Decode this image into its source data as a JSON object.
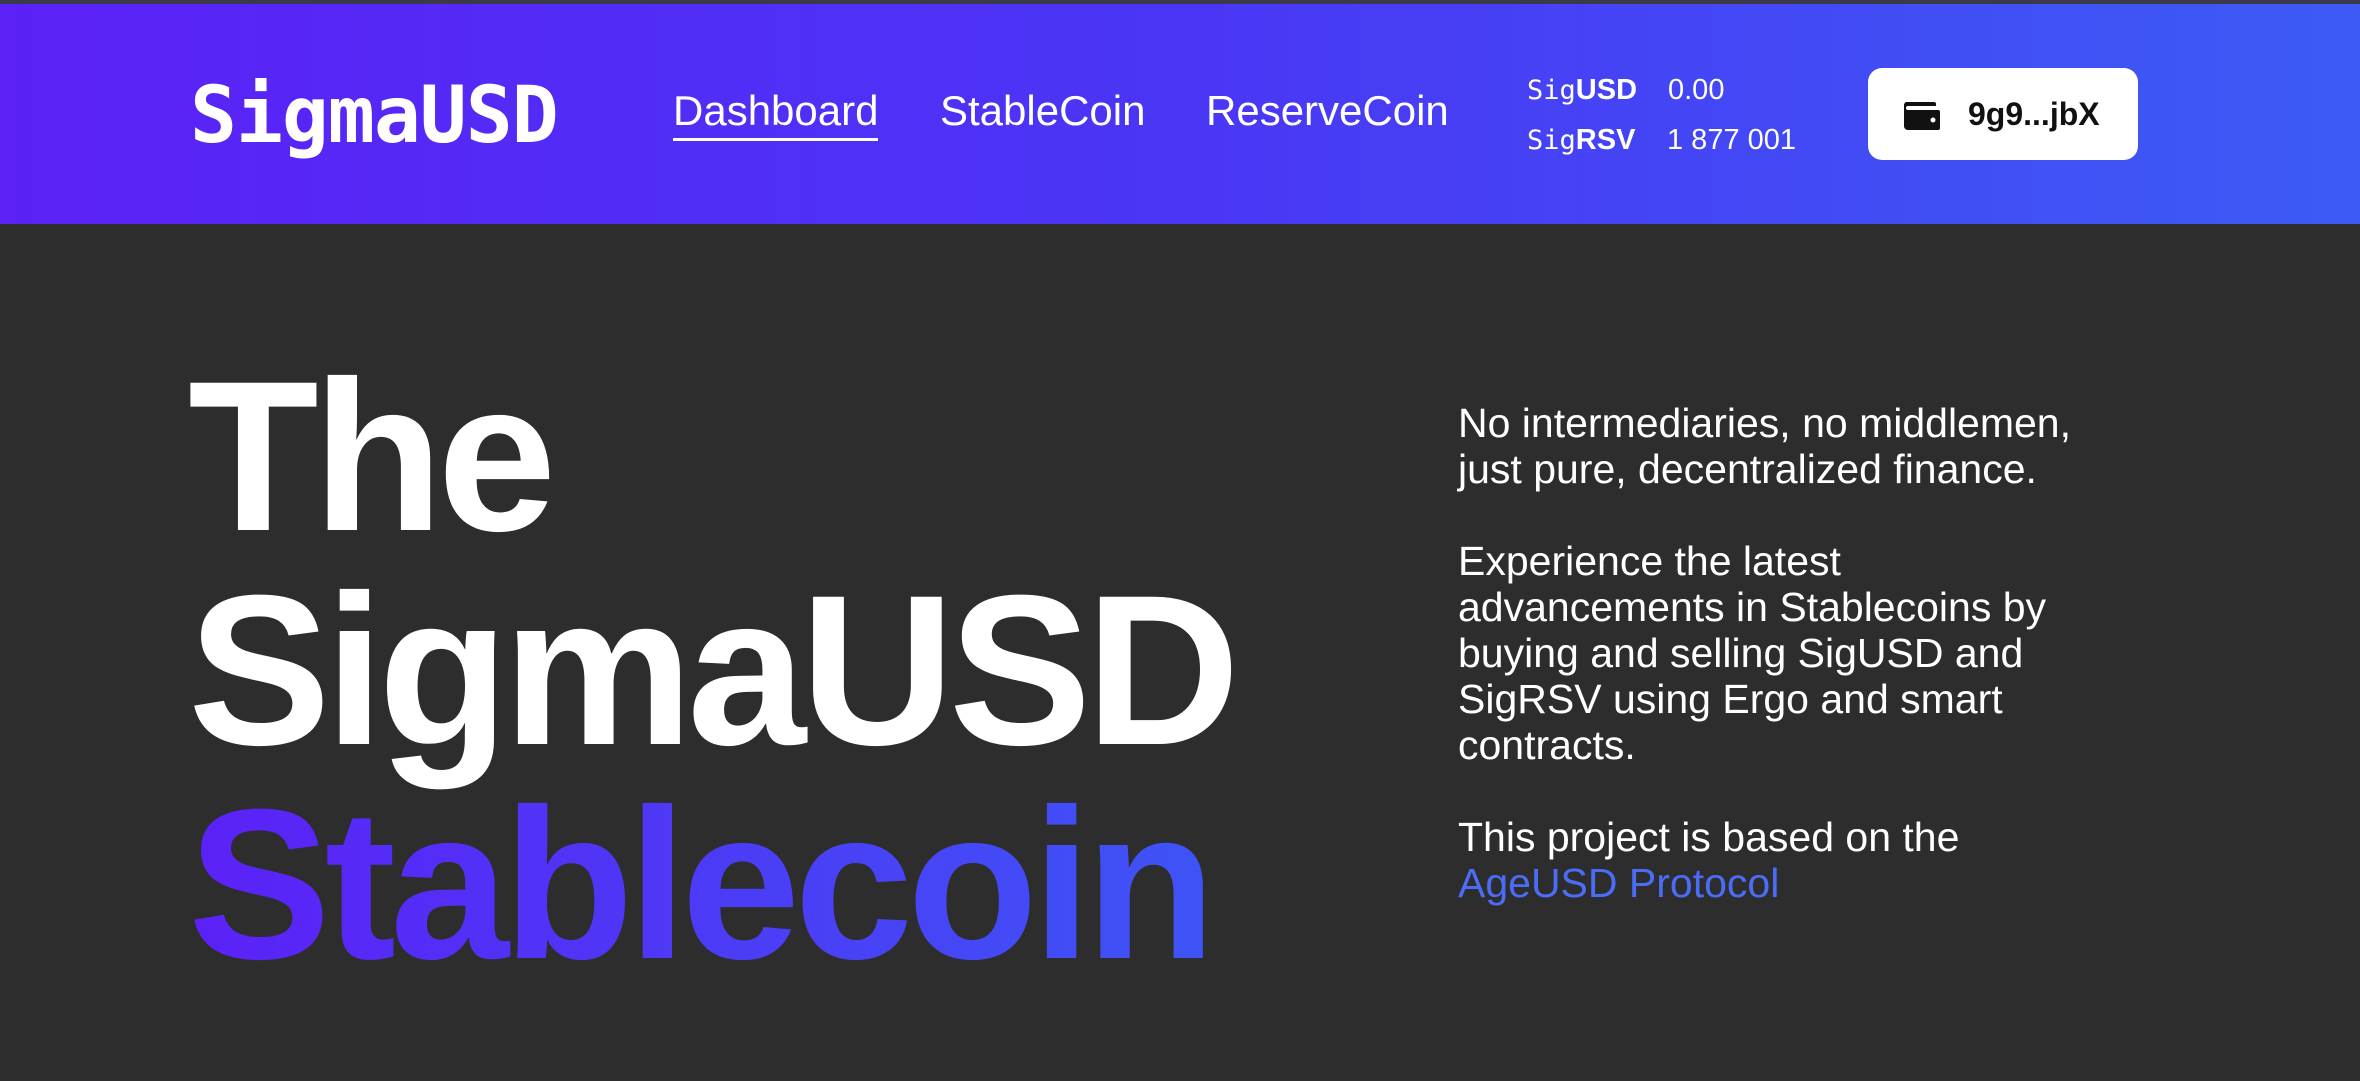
{
  "header": {
    "logo": "SigmaUSD",
    "nav": [
      {
        "label": "Dashboard",
        "active": true
      },
      {
        "label": "StableCoin",
        "active": false
      },
      {
        "label": "ReserveCoin",
        "active": false
      }
    ],
    "balances": [
      {
        "prefix": "Sig",
        "suffix": "USD",
        "value": "0.00"
      },
      {
        "prefix": "Sig",
        "suffix": "RSV",
        "value": "1 877 001"
      }
    ],
    "wallet": {
      "icon": "wallet-icon",
      "address": "9g9...jbX"
    }
  },
  "hero": {
    "line1": "The",
    "line2": "SigmaUSD",
    "line3": "Stablecoin"
  },
  "side": {
    "p1": "No intermediaries, no middlemen, just pure, decentralized finance.",
    "p2": "Experience the latest advancements in Stablecoins by buying and selling SigUSD and SigRSV using Ergo and smart contracts.",
    "p3_text": "This project is based on the",
    "p3_link": "AgeUSD Protocol"
  },
  "colors": {
    "header_gradient_start": "#5b21f7",
    "header_gradient_end": "#3c5bf5",
    "background": "#2d2d2d",
    "link": "#4a6cf7"
  }
}
